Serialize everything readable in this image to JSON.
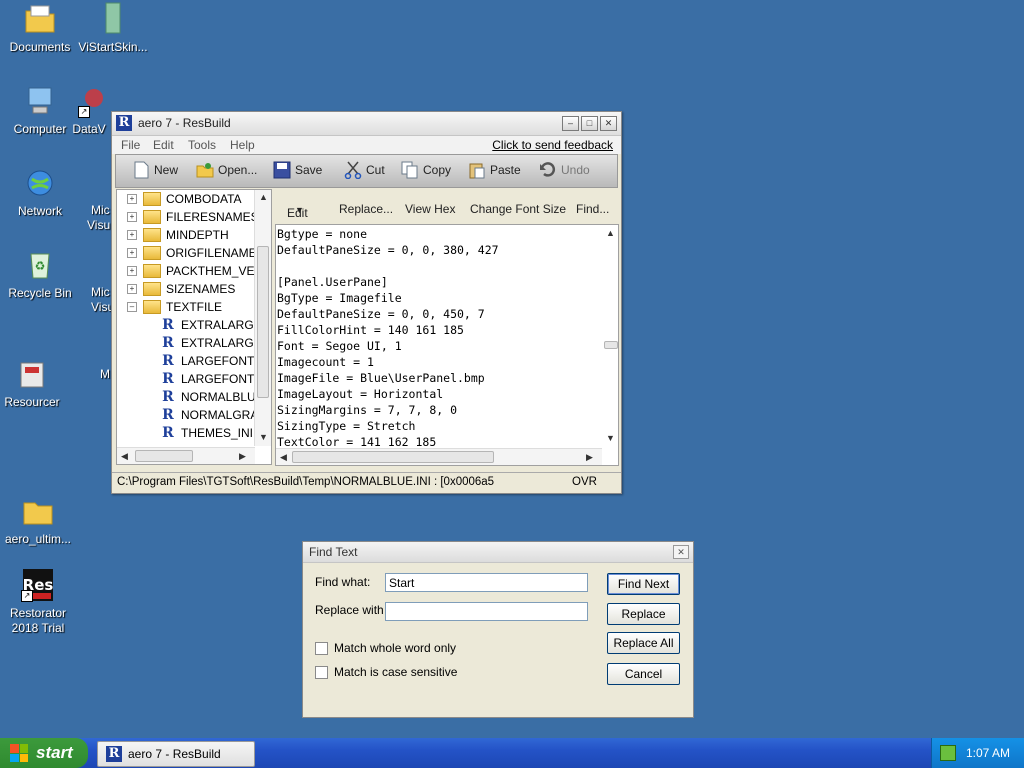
{
  "desktop": {
    "icons": [
      {
        "label": "Documents"
      },
      {
        "label": "ViStartSkin..."
      },
      {
        "label": "Computer"
      },
      {
        "label": "DataV"
      },
      {
        "label": "Network"
      },
      {
        "label": "Recycle Bin"
      },
      {
        "label": "Resourcer"
      },
      {
        "label": "aero_ultim..."
      },
      {
        "label": "Restorator 2018 Trial"
      }
    ],
    "partial_labels": [
      "Mic",
      "Visu",
      "Mic",
      "Visu",
      "M"
    ]
  },
  "window": {
    "title": "aero 7 - ResBuild",
    "menu": [
      "File",
      "Edit",
      "Tools",
      "Help"
    ],
    "feedback_link": "Click to send feedback",
    "toolbar": {
      "new": "New",
      "open": "Open...",
      "save": "Save",
      "cut": "Cut",
      "copy": "Copy",
      "paste": "Paste",
      "undo": "Undo"
    },
    "tree": {
      "folders": [
        "COMBODATA",
        "FILERESNAMES",
        "MINDEPTH",
        "ORIGFILENAMES",
        "PACKTHEM_VER",
        "SIZENAMES",
        "TEXTFILE"
      ],
      "files": [
        "EXTRALARGE",
        "EXTRALARGE",
        "LARGEFONTS",
        "LARGEFONTS",
        "NORMALBLU",
        "NORMALGRA",
        "THEMES_INI"
      ]
    },
    "editbar": {
      "edit": "Edit",
      "replace": "Replace...",
      "view_hex": "View Hex",
      "change_font": "Change Font Size",
      "find": "Find..."
    },
    "code_lines": [
      "Bgtype = none",
      "DefaultPaneSize = 0, 0, 380, 427",
      "",
      "[Panel.UserPane]",
      "BgType = Imagefile",
      "DefaultPaneSize = 0, 0, 450, 7",
      "FillColorHint = 140 161 185",
      "Font = Segoe UI, 1",
      "Imagecount = 1",
      "ImageFile = Blue\\UserPanel.bmp",
      "ImageLayout = Horizontal",
      "SizingMargins = 7, 7, 8, 0",
      "SizingType = Stretch",
      "TextColor = 141 162 185"
    ],
    "status": {
      "path": "C:\\Program Files\\TGTSoft\\ResBuild\\Temp\\NORMALBLUE.INI : [0x0006a5",
      "mode": "OVR"
    }
  },
  "find_dialog": {
    "title": "Find Text",
    "find_label": "Find what:",
    "find_value": "Start",
    "replace_label": "Replace with",
    "replace_value": "",
    "match_whole": "Match whole word only",
    "match_case": "Match is case sensitive",
    "btn_find_next": "Find Next",
    "btn_replace": "Replace",
    "btn_replace_all": "Replace All",
    "btn_cancel": "Cancel"
  },
  "taskbar": {
    "start": "start",
    "task_item": "aero 7 - ResBuild",
    "clock": "1:07 AM"
  }
}
